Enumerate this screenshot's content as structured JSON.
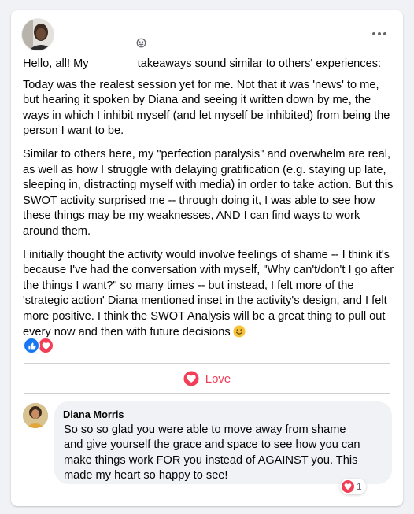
{
  "post": {
    "intro_before": "Hello, all! My",
    "intro_after": "takeaways sound similar to others' experiences:",
    "paragraphs": [
      "Today was the realest session yet for me. Not that it was 'news' to me, but hearing it spoken by Diana and seeing it written down by me, the ways in which I inhibit myself (and let myself be inhibited) from being the person I want to be.",
      "Similar to others here, my \"perfection paralysis\" and overwhelm are real, as well as how I struggle with delaying gratification (e.g. staying up late, sleeping in, distracting myself with media) in order to take action. But this SWOT activity surprised me -- through doing it, I was able to see how these things may be my weaknesses, AND I can find ways to work around them."
    ],
    "last_paragraph": "I initially thought the activity would involve feelings of shame -- I think it's because I've had the conversation with myself, \"Why can't/don't I go after the things I want?\" so many times -- but instead, I felt more of the 'strategic action' Diana mentioned inset in the activity's design, and I felt more positive. I think the SWOT Analysis will be a great thing to pull out every now and then with future decisions",
    "reactions": [
      "like-icon",
      "love-icon"
    ]
  },
  "actions": {
    "love_label": "Love"
  },
  "comment": {
    "author": "Diana Morris",
    "text": "So so so glad you were able to move away from shame and give yourself the grace and space to see how you can make things work FOR you instead of AGAINST you. This made my heart so happy to see!",
    "reaction_count": "1"
  },
  "colors": {
    "love": "#f33e58",
    "like": "#1877f2",
    "background": "#f0f2f5",
    "text": "#050505",
    "secondary_text": "#65676b"
  }
}
